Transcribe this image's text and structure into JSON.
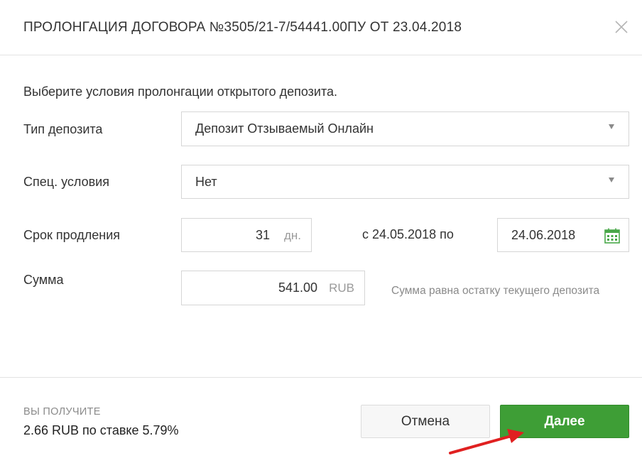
{
  "dialog": {
    "title": "ПРОЛОНГАЦИЯ ДОГОВОРА №3505/21-7/54441.00ПУ ОТ 23.04.2018",
    "intro": "Выберите условия пролонгации открытого депозита."
  },
  "form": {
    "deposit_type": {
      "label": "Тип депозита",
      "value": "Депозит Отзываемый Онлайн"
    },
    "special_conditions": {
      "label": "Спец. условия",
      "value": "Нет"
    },
    "extension": {
      "label": "Срок продления",
      "days": "31",
      "days_unit": "дн.",
      "range_text": "с 24.05.2018 по",
      "end_date": "24.06.2018"
    },
    "amount": {
      "label": "Сумма",
      "value": "541.00",
      "currency": "RUB",
      "hint": "Сумма равна остатку текущего депозита"
    }
  },
  "footer": {
    "receive_label": "ВЫ ПОЛУЧИТЕ",
    "receive_value": "2.66 RUB по ставке 5.79%",
    "cancel_label": "Отмена",
    "next_label": "Далее"
  },
  "colors": {
    "primary_button": "#3e9e36",
    "calendar_icon": "#4aa84a",
    "annotation_arrow": "#e02020"
  },
  "icons": {
    "close": "close-icon",
    "calendar": "calendar-icon",
    "dropdown": "chevron-down-icon"
  }
}
